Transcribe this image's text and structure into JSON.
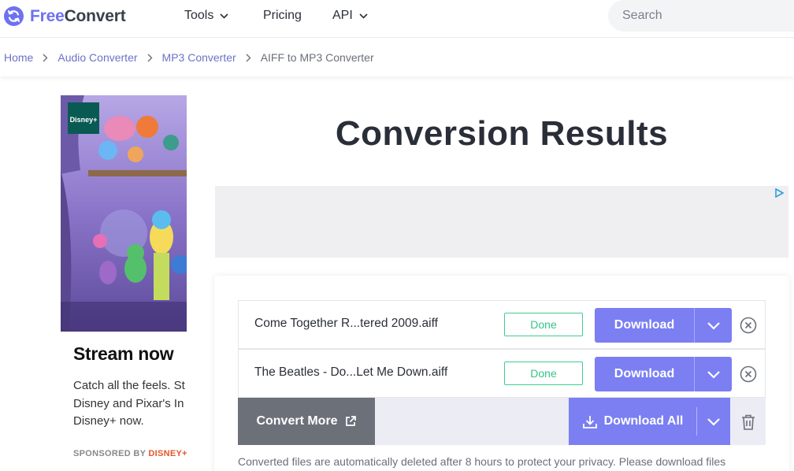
{
  "header": {
    "logo_text_accent": "Free",
    "logo_text_rest": "Convert",
    "nav": [
      {
        "label": "Tools",
        "has_dropdown": true
      },
      {
        "label": "Pricing",
        "has_dropdown": false
      },
      {
        "label": "API",
        "has_dropdown": true
      }
    ],
    "search_placeholder": "Search"
  },
  "breadcrumb": {
    "items": [
      "Home",
      "Audio Converter",
      "MP3 Converter"
    ],
    "current": "AIFF to MP3 Converter"
  },
  "ad": {
    "badge": "Disney+",
    "title": "Stream now",
    "body_lines": [
      "Catch all the feels. St",
      "Disney and Pixar's In",
      "Disney+ now."
    ],
    "sponsored_prefix": "SPONSORED BY ",
    "sponsor": "DISNEY+"
  },
  "main": {
    "title": "Conversion Results",
    "files": [
      {
        "name": "Come Together R...tered 2009.aiff",
        "status": "Done",
        "download_label": "Download"
      },
      {
        "name": "The Beatles - Do...Let Me Down.aiff",
        "status": "Done",
        "download_label": "Download"
      }
    ],
    "convert_more_label": "Convert More",
    "download_all_label": "Download All",
    "privacy_note": "Converted files are automatically deleted after 8 hours to protect your privacy. Please download files"
  },
  "colors": {
    "brand": "#6c72f0",
    "download_button": "#7b7ff2",
    "done_badge": "#3ccf8e",
    "convert_more": "#6c7079"
  },
  "icons": [
    "logo-sync-icon",
    "chevron-down-icon",
    "chevron-right-icon",
    "adchoices-icon",
    "remove-circle-icon",
    "external-link-icon",
    "download-icon",
    "trash-icon"
  ]
}
